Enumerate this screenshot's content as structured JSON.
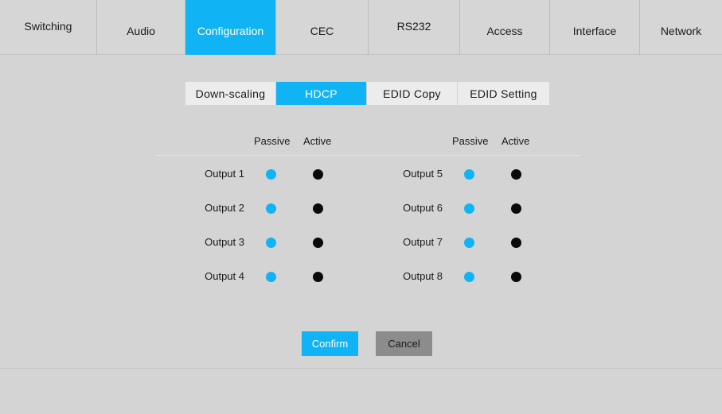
{
  "nav": {
    "tabs": [
      {
        "label": "Switching"
      },
      {
        "label": "Audio"
      },
      {
        "label": "Configuration"
      },
      {
        "label": "CEC"
      },
      {
        "label": "RS232"
      },
      {
        "label": "Access"
      },
      {
        "label": "Interface"
      },
      {
        "label": "Network"
      }
    ],
    "active": "Configuration"
  },
  "subtabs": {
    "items": [
      {
        "label": "Down-scaling"
      },
      {
        "label": "HDCP"
      },
      {
        "label": "EDID Copy"
      },
      {
        "label": "EDID Setting"
      }
    ],
    "active": "HDCP"
  },
  "hdcp": {
    "columns": {
      "passive": "Passive",
      "active": "Active"
    },
    "outputs": [
      {
        "label": "Output 1",
        "selected": "passive"
      },
      {
        "label": "Output 2",
        "selected": "passive"
      },
      {
        "label": "Output 3",
        "selected": "passive"
      },
      {
        "label": "Output 4",
        "selected": "passive"
      },
      {
        "label": "Output 5",
        "selected": "passive"
      },
      {
        "label": "Output 6",
        "selected": "passive"
      },
      {
        "label": "Output 7",
        "selected": "passive"
      },
      {
        "label": "Output 8",
        "selected": "passive"
      }
    ]
  },
  "buttons": {
    "confirm": "Confirm",
    "cancel": "Cancel"
  },
  "colors": {
    "accent": "#10b4f5",
    "background": "#d4d4d4",
    "active_dot": "#0a0a0a",
    "cancel_button": "#8c8c8c"
  }
}
